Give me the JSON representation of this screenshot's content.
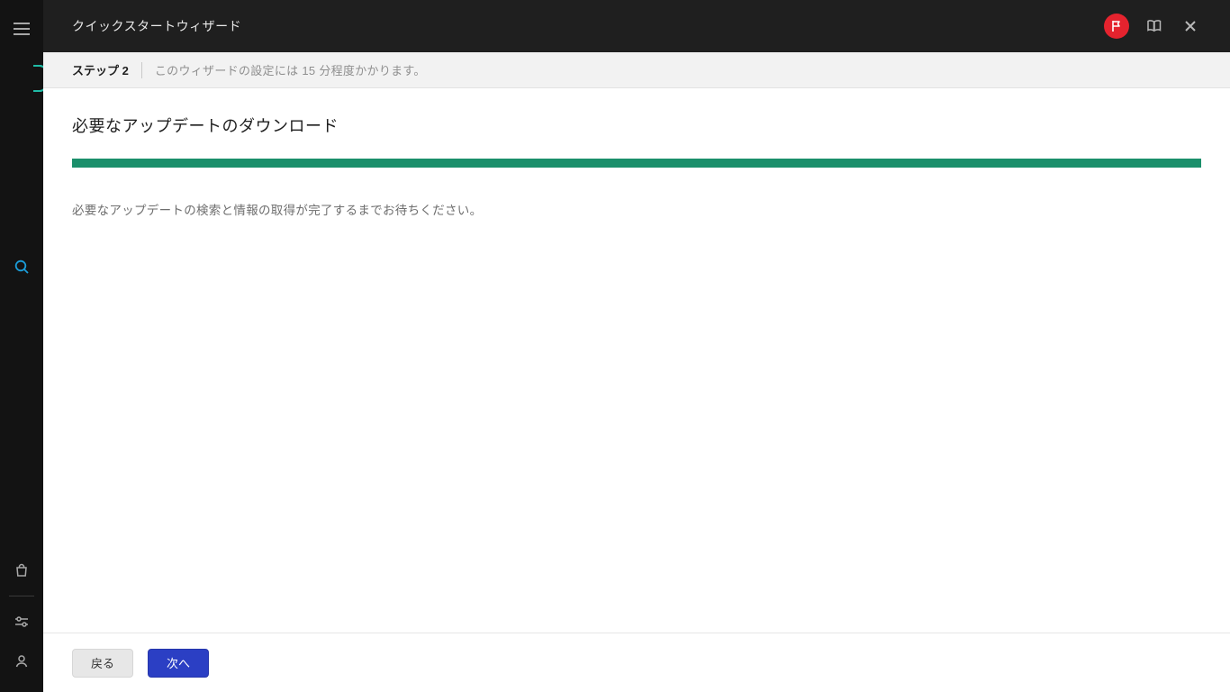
{
  "sidebar": {
    "icons": {
      "menu": "menu-icon",
      "brand": "brand-icon",
      "search": "search-icon",
      "bag": "bag-icon",
      "sliders": "sliders-icon",
      "user": "user-icon"
    }
  },
  "header": {
    "title": "クイックスタートウィザード",
    "actions": {
      "flag": "flag-icon",
      "book": "book-icon",
      "close": "close-icon"
    }
  },
  "stepbar": {
    "step_label": "ステップ 2",
    "step_desc": "このウィザードの設定には 15 分程度かかります。"
  },
  "content": {
    "heading": "必要なアップデートのダウンロード",
    "wait_text": "必要なアップデートの検索と情報の取得が完了するまでお待ちください。",
    "progress_percent": 100
  },
  "footer": {
    "back_label": "戻る",
    "next_label": "次へ"
  },
  "colors": {
    "accent_green": "#1b8f6b",
    "accent_blue": "#2b3fc4",
    "brand_teal": "#1fbba6",
    "danger_red": "#e5232e"
  }
}
